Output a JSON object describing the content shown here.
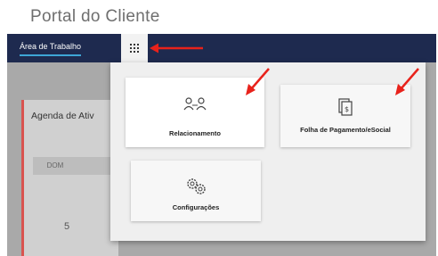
{
  "page": {
    "title": "Portal do Cliente"
  },
  "navbar": {
    "tab_label": "Área de Trabalho"
  },
  "agenda": {
    "title": "Agenda de Ativ",
    "weekday": "DOM",
    "day": "5"
  },
  "apps_menu": {
    "tiles": [
      {
        "label": "Relacionamento",
        "icon": "people-connect-icon"
      },
      {
        "label": "Folha de Pagamento/eSocial",
        "icon": "document-payroll-icon"
      },
      {
        "label": "Configurações",
        "icon": "gears-icon"
      }
    ]
  },
  "colors": {
    "navbar": "#1e2a4f",
    "tab_underline": "#3ea6d6",
    "arrow": "#e8221b",
    "agenda_accent": "#d9534f"
  }
}
